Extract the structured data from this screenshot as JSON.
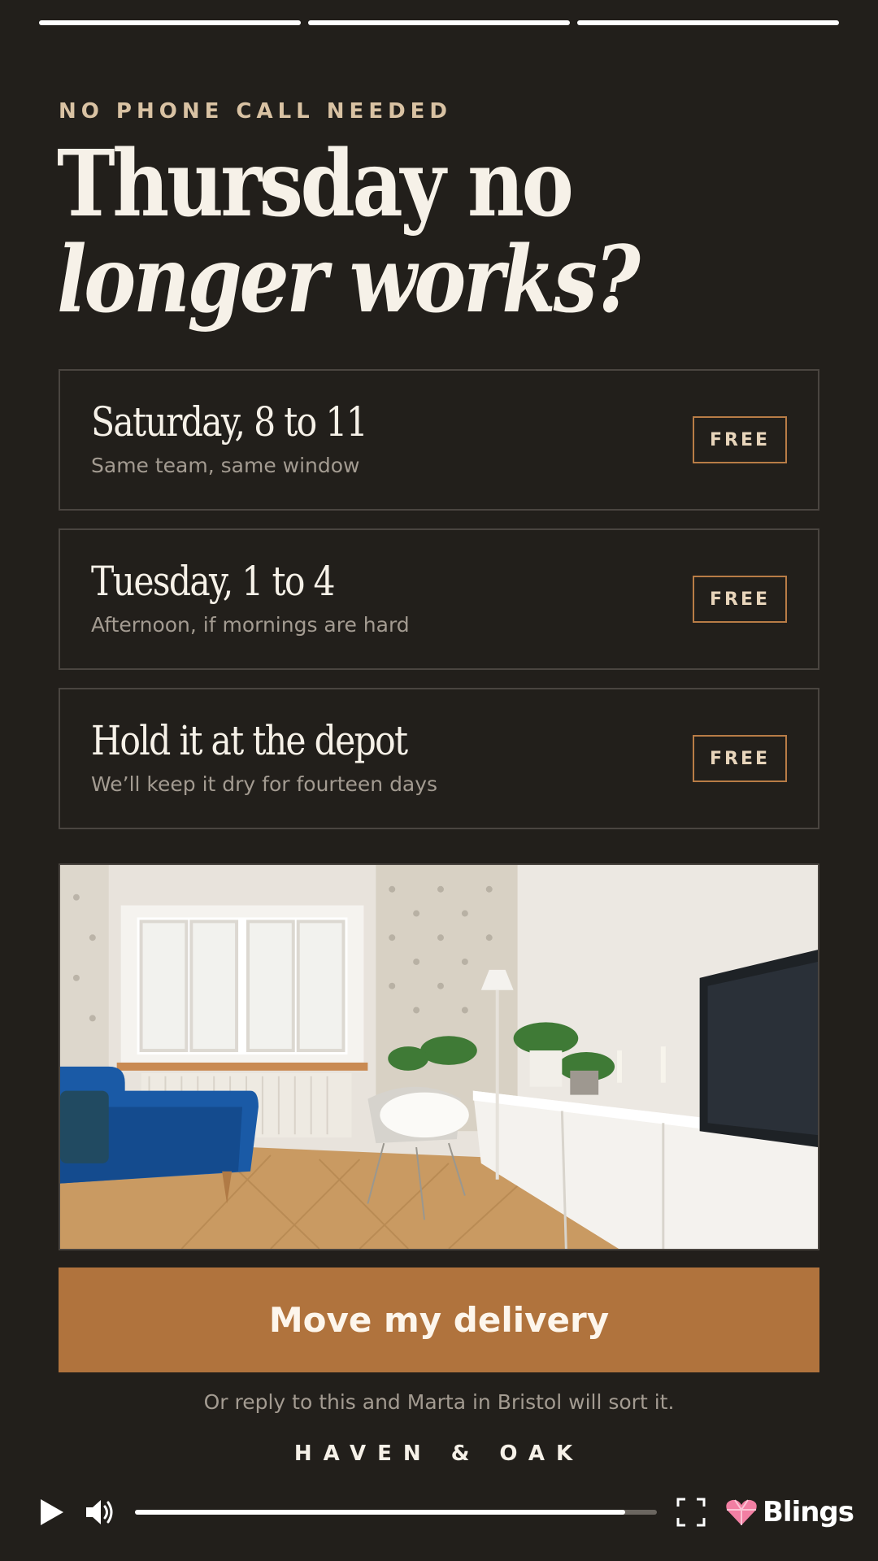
{
  "story": {
    "segments": 3
  },
  "eyebrow": "NO PHONE CALL NEEDED",
  "headline": {
    "line1": "Thursday no",
    "line2": "longer works?"
  },
  "options": [
    {
      "title": "Saturday, 8 to 11",
      "subtitle": "Same team, same window",
      "badge": "FREE"
    },
    {
      "title": "Tuesday, 1 to 4",
      "subtitle": "Afternoon, if mornings are hard",
      "badge": "FREE"
    },
    {
      "title": "Hold it at the depot",
      "subtitle": "We’ll keep it dry for fourteen days",
      "badge": "FREE"
    }
  ],
  "photo": {
    "icon": "living-room-photo"
  },
  "cta": {
    "label": "Move my delivery"
  },
  "reply_text": "Or reply to this and Marta in Bristol will sort it.",
  "brand": "HAVEN & OAK",
  "player": {
    "progress": 0.94,
    "play_icon": "play-icon",
    "volume_icon": "volume-icon",
    "fullscreen_icon": "fullscreen-icon",
    "logo_text": "Blings"
  },
  "colors": {
    "background": "#221f1b",
    "accent": "#b0733d",
    "badge_border": "#b87c46",
    "eyebrow": "#d9c2a3"
  }
}
